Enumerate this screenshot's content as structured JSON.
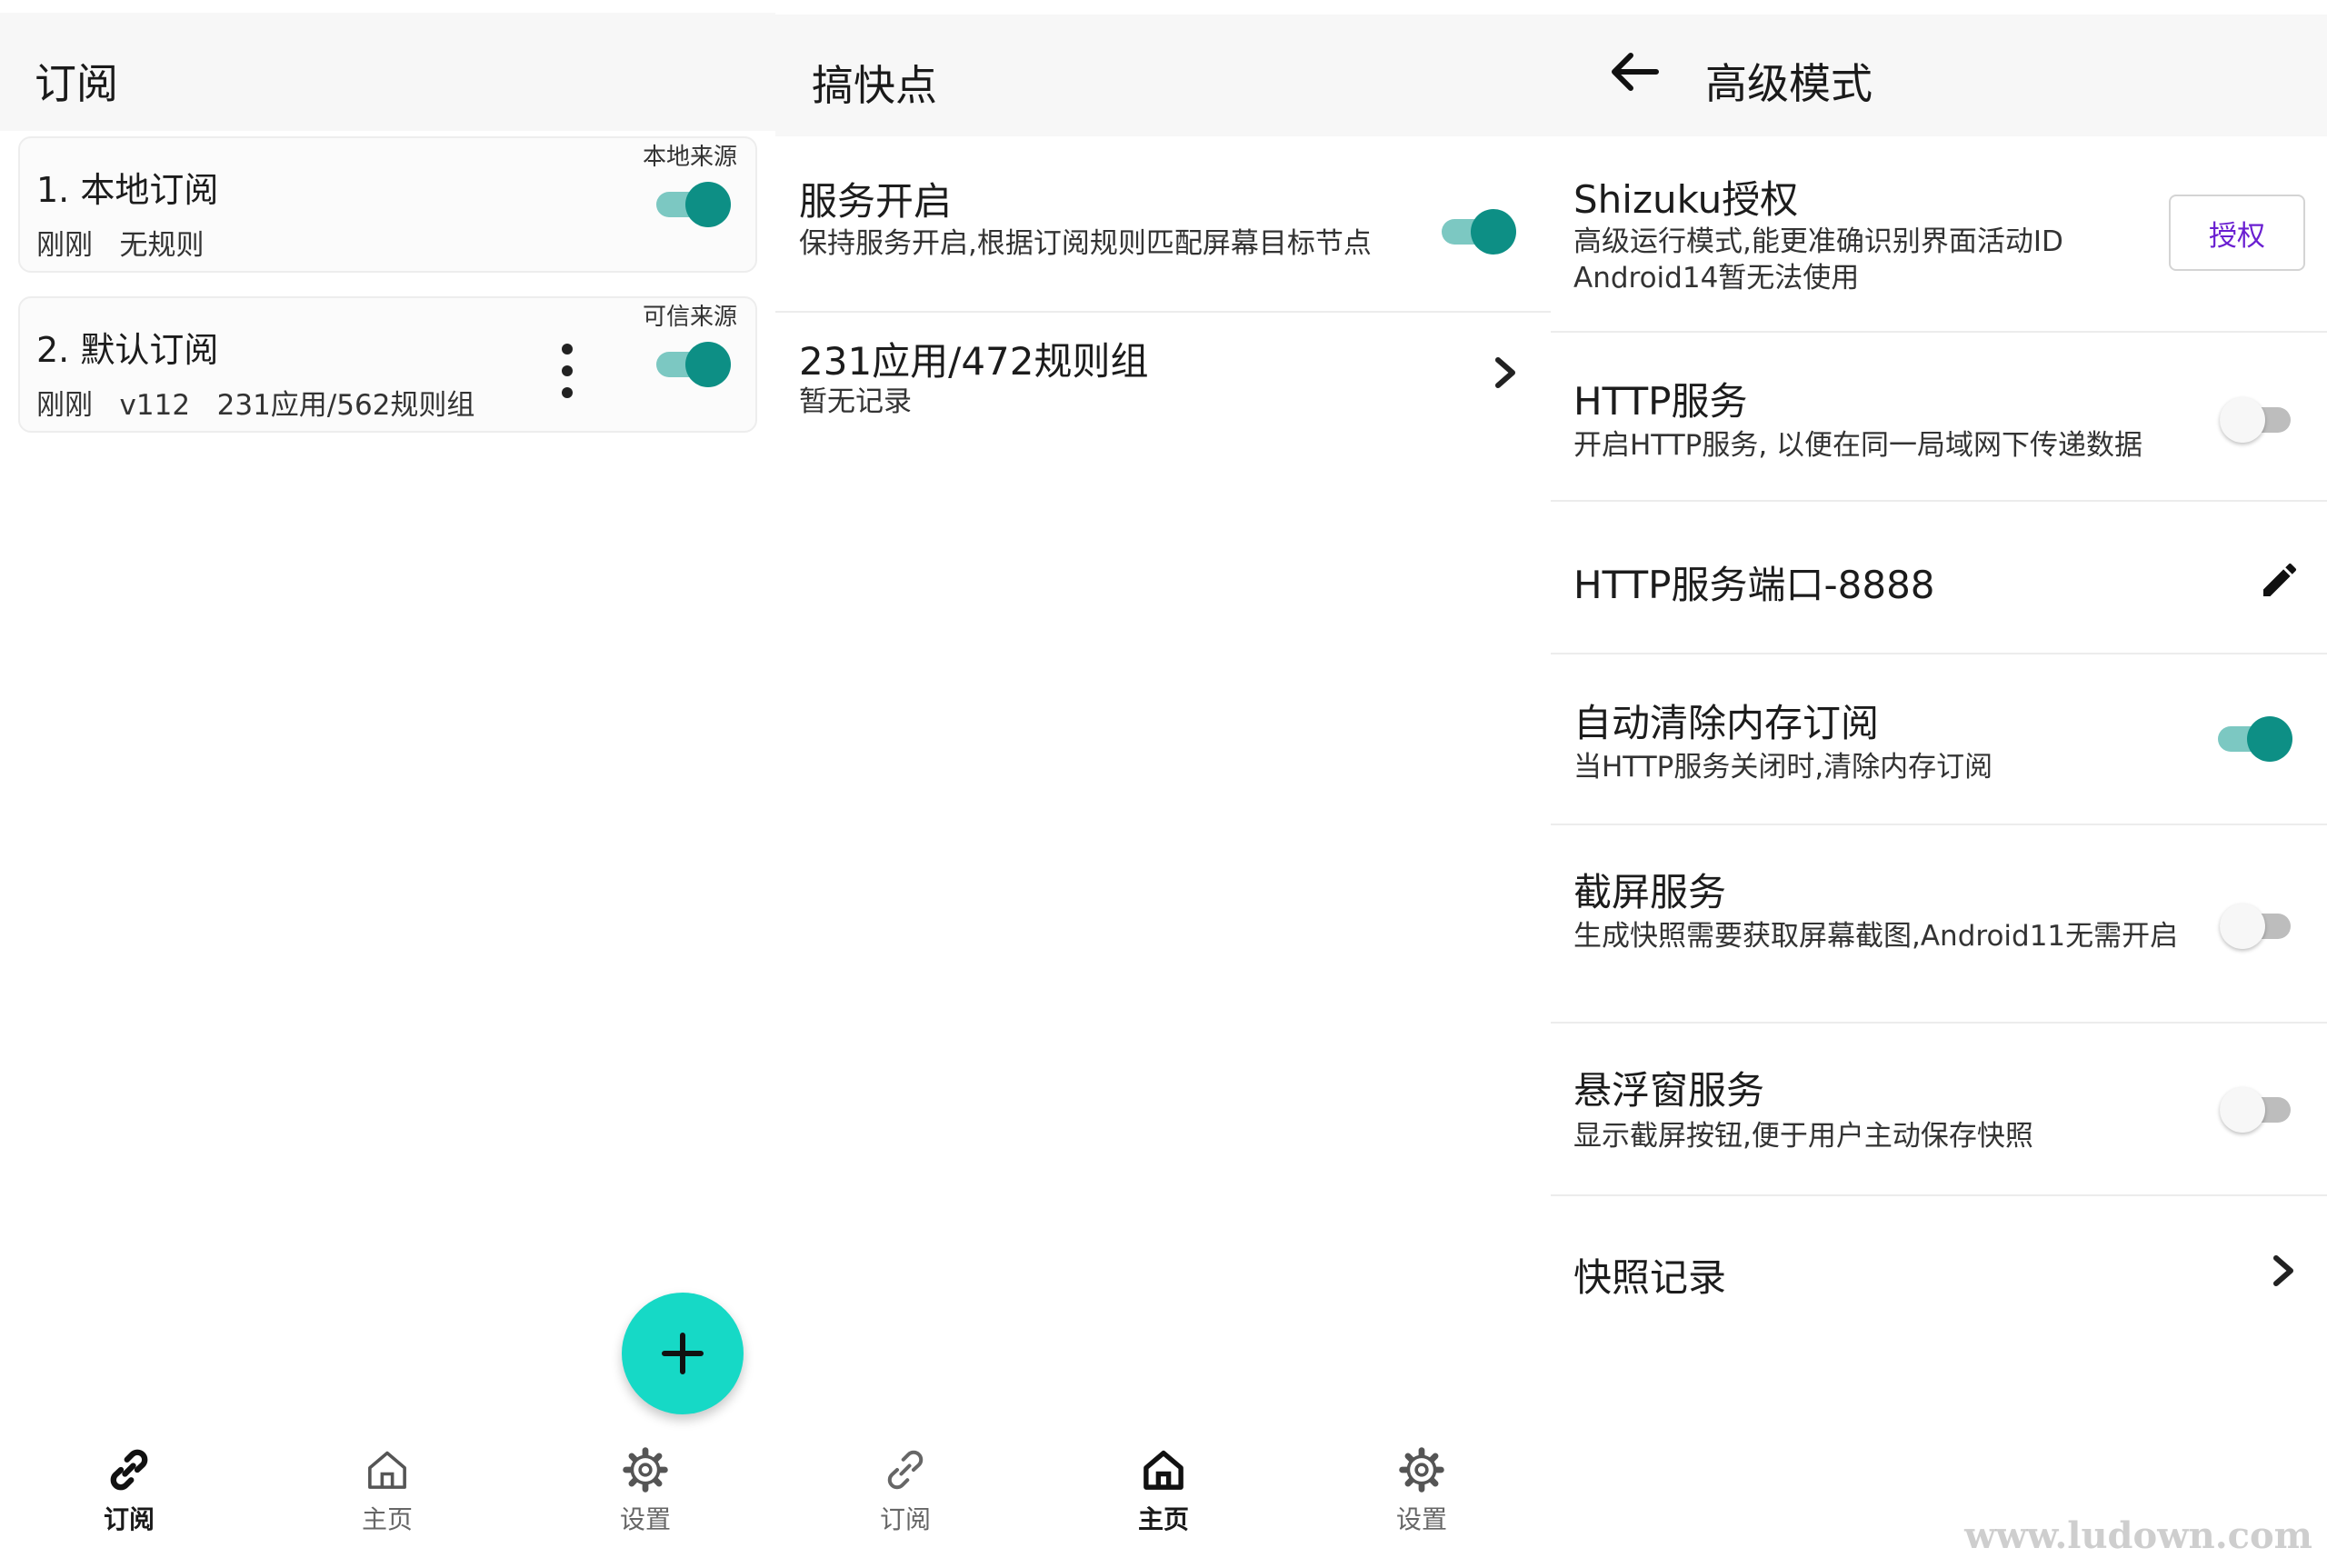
{
  "colors": {
    "accent": "#0d8f85",
    "switch_track_on": "#7cc8c2",
    "fab": "#16d9c6",
    "auth_text": "#6a1fd1"
  },
  "subscriptions_screen": {
    "title": "订阅",
    "cards": [
      {
        "title": "1. 本地订阅",
        "meta": "刚刚   无规则",
        "tag": "本地来源",
        "enabled": true,
        "has_menu": false
      },
      {
        "title": "2. 默认订阅",
        "meta": "刚刚   v112   231应用/562规则组",
        "tag": "可信来源",
        "enabled": true,
        "has_menu": true
      }
    ],
    "fab_icon": "plus-icon",
    "nav": [
      {
        "label": "订阅",
        "icon": "link-icon",
        "active": true
      },
      {
        "label": "主页",
        "icon": "home-icon",
        "active": false
      },
      {
        "label": "设置",
        "icon": "gear-icon",
        "active": false
      }
    ]
  },
  "home_screen": {
    "title": "搞快点",
    "service": {
      "title": "服务开启",
      "desc": "保持服务开启,根据订阅规则匹配屏幕目标节点",
      "enabled": true
    },
    "rules": {
      "title": "231应用/472规则组",
      "desc": "暂无记录"
    },
    "nav": [
      {
        "label": "订阅",
        "icon": "link-icon",
        "active": false
      },
      {
        "label": "主页",
        "icon": "home-icon",
        "active": true
      },
      {
        "label": "设置",
        "icon": "gear-icon",
        "active": false
      }
    ]
  },
  "advanced_screen": {
    "back_icon": "arrow-back-icon",
    "title": "高级模式",
    "shizuku": {
      "title": "Shizuku授权",
      "desc_line1": "高级运行模式,能更准确识别界面活动ID",
      "desc_line2": "Android14暂无法使用",
      "button": "授权"
    },
    "http_service": {
      "title": "HTTP服务",
      "desc": "开启HTTP服务, 以便在同一局域网下传递数据",
      "enabled": false
    },
    "http_port": {
      "title": "HTTP服务端口-8888",
      "icon": "pencil-icon"
    },
    "auto_clear": {
      "title": "自动清除内存订阅",
      "desc": "当HTTP服务关闭时,清除内存订阅",
      "enabled": true
    },
    "screenshot": {
      "title": "截屏服务",
      "desc": "生成快照需要获取屏幕截图,Android11无需开启",
      "enabled": false
    },
    "floating": {
      "title": "悬浮窗服务",
      "desc": "显示截屏按钮,便于用户主动保存快照",
      "enabled": false
    },
    "snapshot": {
      "title": "快照记录"
    }
  },
  "watermark": "www.ludown.com"
}
